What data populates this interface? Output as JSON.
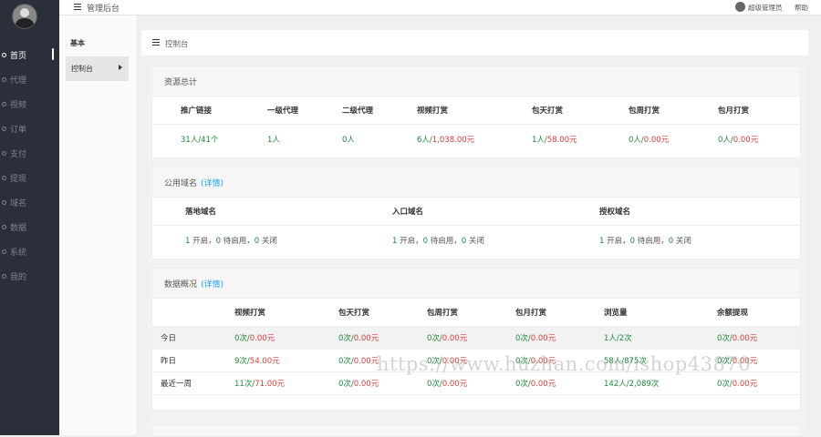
{
  "header": {
    "title": "管理后台",
    "user_name": "超级管理员",
    "help": "帮助"
  },
  "sidebar": {
    "items": [
      {
        "label": "首页",
        "active": true
      },
      {
        "label": "代理"
      },
      {
        "label": "视频"
      },
      {
        "label": "订单"
      },
      {
        "label": "支付"
      },
      {
        "label": "提现"
      },
      {
        "label": "域名"
      },
      {
        "label": "数据"
      },
      {
        "label": "系统"
      },
      {
        "label": "我的"
      }
    ]
  },
  "subnav": {
    "group": "基本",
    "item": "控制台"
  },
  "breadcrumb": {
    "text": "控制台"
  },
  "resources": {
    "title": "资源总计",
    "headers": [
      "推广链接",
      "一级代理",
      "二级代理",
      "视频打赏",
      "包天打赏",
      "包周打赏",
      "包月打赏"
    ],
    "values": [
      {
        "a": "31人/41个",
        "b": ""
      },
      {
        "a": "1人",
        "b": ""
      },
      {
        "a": "0人",
        "b": ""
      },
      {
        "a": "6人/",
        "b": "1,038.00元"
      },
      {
        "a": "1人/",
        "b": "58.00元"
      },
      {
        "a": "0人/",
        "b": "0.00元"
      },
      {
        "a": "0人/",
        "b": "0.00元"
      }
    ]
  },
  "domains": {
    "title": "公用域名",
    "detail": "(详情)",
    "headers": [
      "落地域名",
      "入口域名",
      "授权域名"
    ],
    "rows": [
      {
        "on": "1",
        "on_label": " 开启，",
        "pending": "0",
        "pending_label": " 待启用，",
        "off": "0",
        "off_label": " 关闭"
      },
      {
        "on": "1",
        "on_label": " 开启，",
        "pending": "0",
        "pending_label": " 待启用，",
        "off": "0",
        "off_label": " 关闭"
      },
      {
        "on": "1",
        "on_label": " 开启，",
        "pending": "0",
        "pending_label": " 待启用，",
        "off": "0",
        "off_label": " 关闭"
      }
    ]
  },
  "overview": {
    "title": "数据概况",
    "detail": "(详情)",
    "headers": [
      "",
      "视频打赏",
      "包天打赏",
      "包周打赏",
      "包月打赏",
      "浏览量",
      "余额提现"
    ],
    "rows": [
      {
        "label": "今日",
        "cells": [
          [
            "0次/",
            "0.00元"
          ],
          [
            "0次/",
            "0.00元"
          ],
          [
            "0次/",
            "0.00元"
          ],
          [
            "0次/",
            "0.00元"
          ],
          [
            "1人/2次",
            ""
          ],
          [
            "0次/",
            "0.00元"
          ]
        ]
      },
      {
        "label": "昨日",
        "cells": [
          [
            "9次/",
            "54.00元"
          ],
          [
            "0次/",
            "0.00元"
          ],
          [
            "0次/",
            "0.00元"
          ],
          [
            "0次/",
            "0.00元"
          ],
          [
            "58人/875次",
            ""
          ],
          [
            "0次/",
            "0.00元"
          ]
        ]
      },
      {
        "label": "最近一周",
        "cells": [
          [
            "11次/",
            "71.00元"
          ],
          [
            "0次/",
            "0.00元"
          ],
          [
            "0次/",
            "0.00元"
          ],
          [
            "0次/",
            "0.00元"
          ],
          [
            "142人/2,089次",
            ""
          ],
          [
            "0次/",
            "0.00元"
          ]
        ]
      }
    ]
  },
  "watermark": "https://www.huzhan.com/ishop43870",
  "colors": {
    "sidebar_bg": "#2a2f3a",
    "green": "#1c8a3a",
    "red": "#e03a3a",
    "link": "#1E9FFF"
  }
}
